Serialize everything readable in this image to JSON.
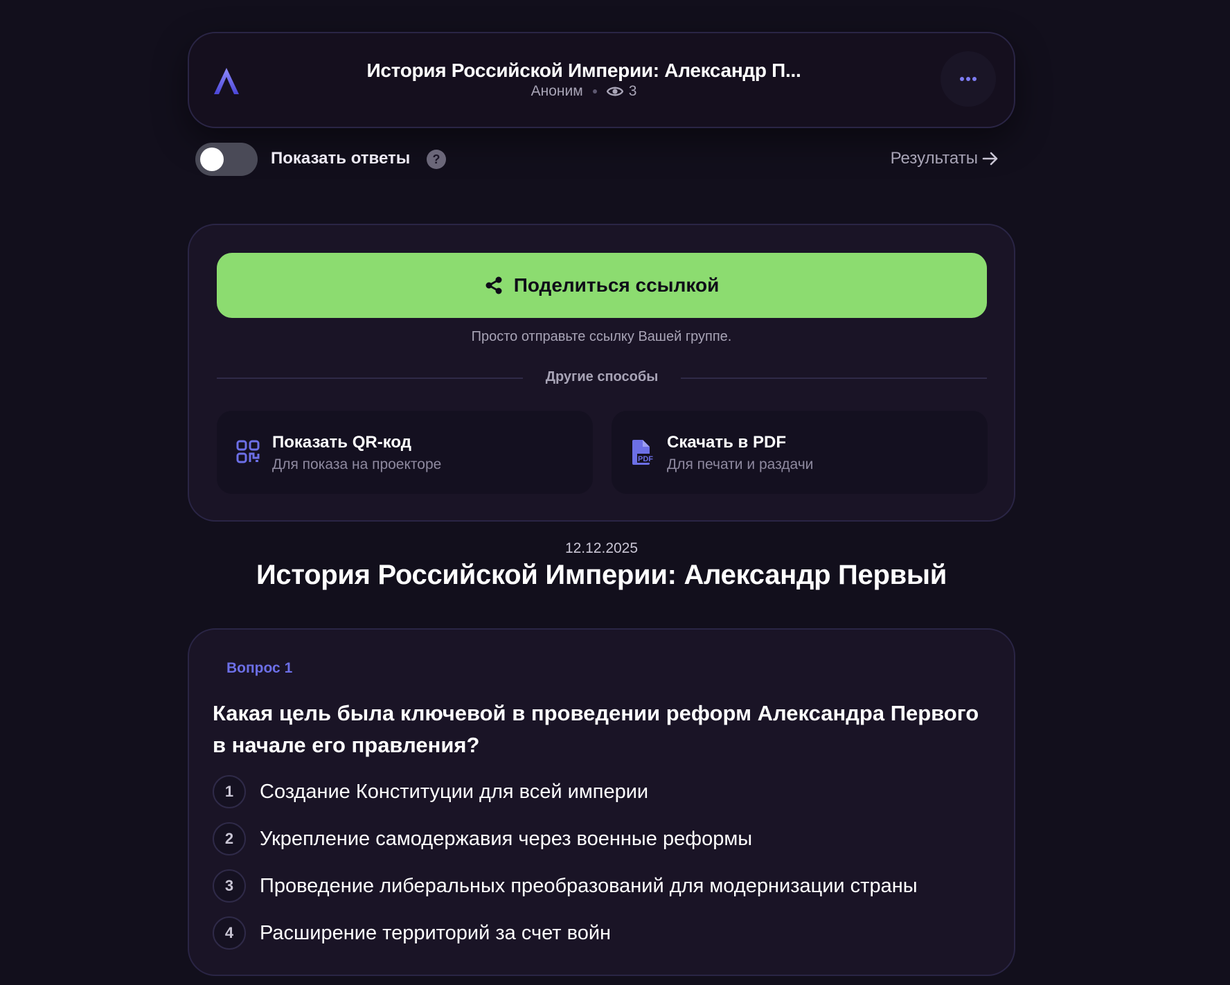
{
  "header": {
    "title": "История Российской Империи: Александр П...",
    "author": "Аноним",
    "views": "3"
  },
  "controls": {
    "show_answers_label": "Показать ответы",
    "show_answers_on": false,
    "help_glyph": "?",
    "results_label": "Результаты"
  },
  "share": {
    "button_label": "Поделиться ссылкой",
    "hint": "Просто отправьте ссылку Вашей группе.",
    "other_label": "Другие способы",
    "options": [
      {
        "title": "Показать QR-код",
        "subtitle": "Для показа на проекторе",
        "icon": "qr-code-icon"
      },
      {
        "title": "Скачать в PDF",
        "subtitle": "Для печати и раздачи",
        "icon": "pdf-file-icon"
      }
    ]
  },
  "quiz": {
    "date": "12.12.2025",
    "title": "История Российской Империи: Александр Первый"
  },
  "question": {
    "label": "Вопрос 1",
    "text": "Какая цель была ключевой в проведении реформ Александра Первого в начале его правления?",
    "answers": [
      {
        "num": "1",
        "text": "Создание Конституции для всей империи"
      },
      {
        "num": "2",
        "text": "Укрепление самодержавия через военные реформы"
      },
      {
        "num": "3",
        "text": "Проведение либеральных преобразований для модернизации страны"
      },
      {
        "num": "4",
        "text": "Расширение территорий за счет войн"
      }
    ]
  },
  "colors": {
    "background": "#120f1c",
    "card": "#1a1426",
    "accent_green": "#8cdc70",
    "accent_purple": "#6c6fe6",
    "muted_text": "#a8a4b6"
  }
}
